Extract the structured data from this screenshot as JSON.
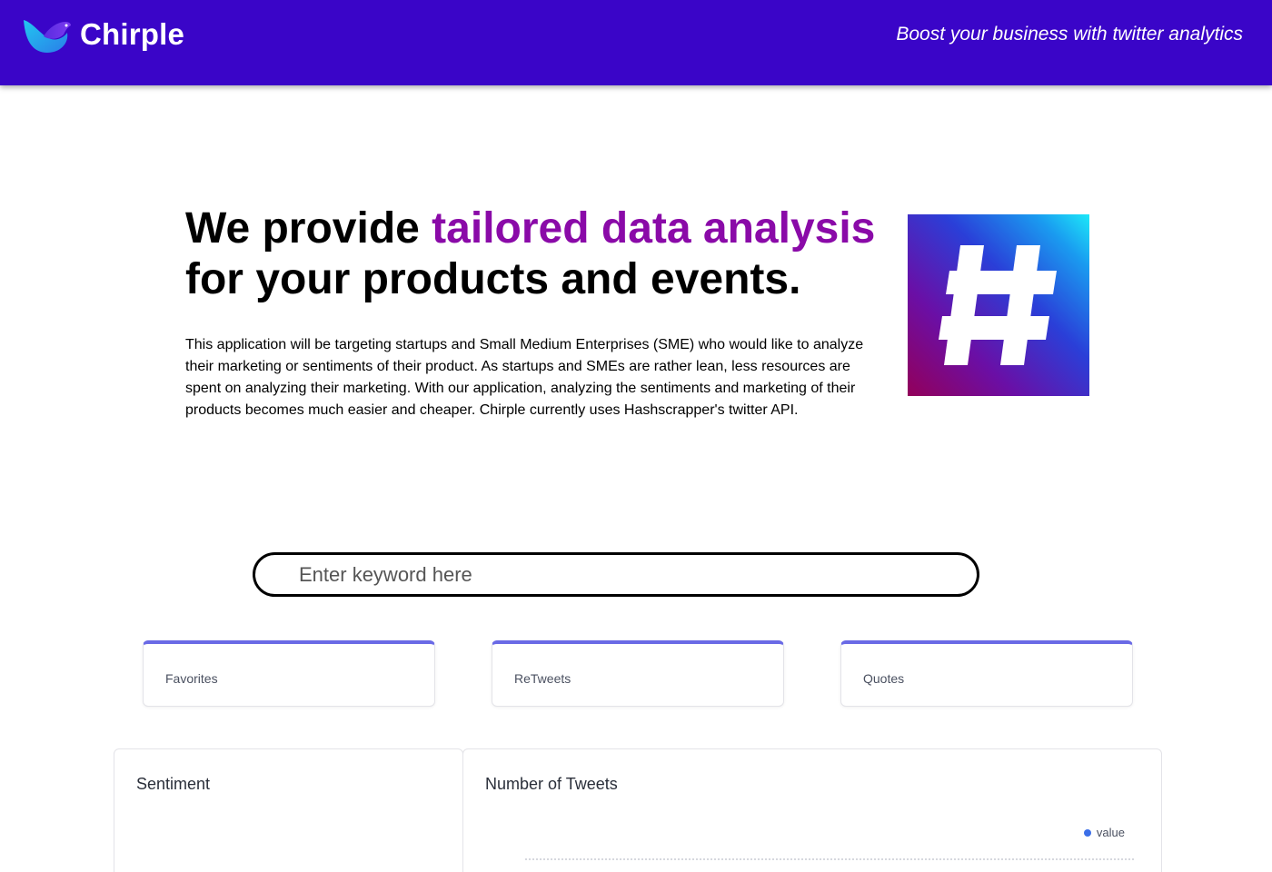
{
  "header": {
    "brand": "Chirple",
    "tagline": "Boost your business with twitter analytics"
  },
  "hero": {
    "title_part1": "We provide ",
    "title_accent": "tailored data analysis",
    "title_part2": " for your products and events.",
    "description": "This application will be targeting startups and Small Medium Enterprises (SME) who would like to analyze their marketing or sentiments of their product. As startups and SMEs are rather lean, less resources are spent on analyzing their marketing. With our application, analyzing the sentiments and marketing of their products becomes much easier and cheaper. Chirple currently uses Hashscrapper's twitter API.",
    "image_icon": "hashtag-icon"
  },
  "search": {
    "placeholder": "Enter keyword here",
    "value": ""
  },
  "stats": [
    {
      "label": "Favorites"
    },
    {
      "label": "ReTweets"
    },
    {
      "label": "Quotes"
    }
  ],
  "panels": {
    "sentiment": {
      "title": "Sentiment"
    },
    "tweets": {
      "title": "Number of Tweets",
      "legend": "value"
    }
  },
  "colors": {
    "header_bg": "#3a05c8",
    "accent_text": "#8a0aa8",
    "card_top_border": "#6a6ae6",
    "legend_dot": "#3b6fe8"
  }
}
